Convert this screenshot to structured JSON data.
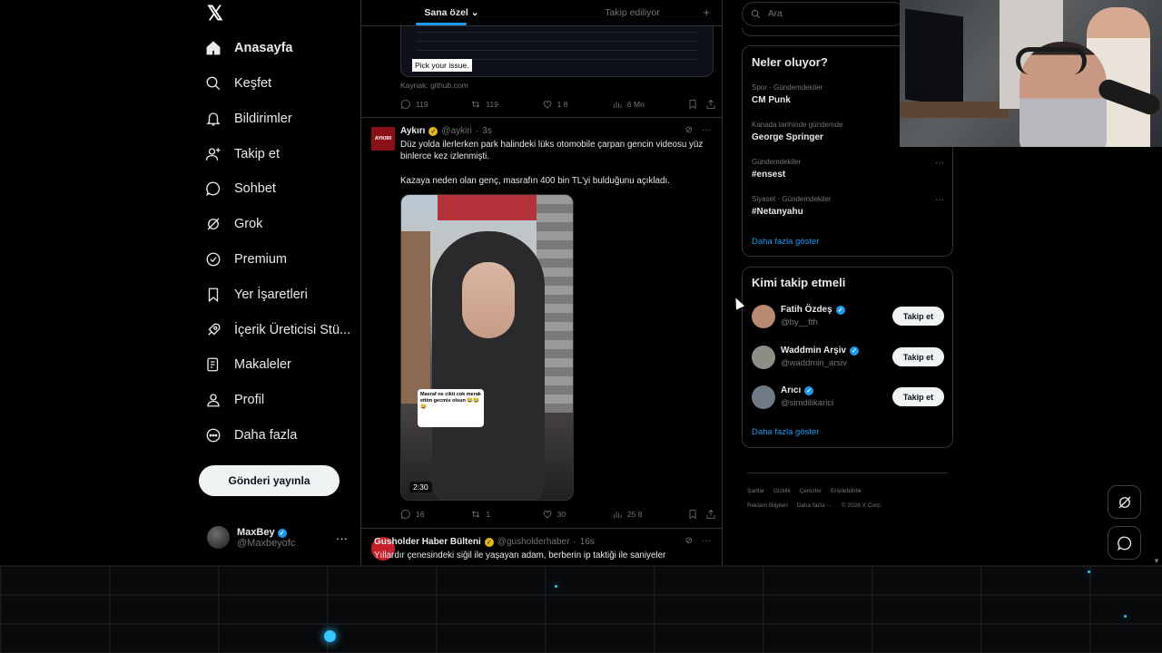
{
  "nav": {
    "logo": "𝕏",
    "items": [
      {
        "label": "Anasayfa",
        "icon": "home-icon"
      },
      {
        "label": "Keşfet",
        "icon": "search-icon"
      },
      {
        "label": "Bildirimler",
        "icon": "bell-icon"
      },
      {
        "label": "Takip et",
        "icon": "person-add-icon"
      },
      {
        "label": "Sohbet",
        "icon": "chat-icon"
      },
      {
        "label": "Grok",
        "icon": "grok-icon"
      },
      {
        "label": "Premium",
        "icon": "premium-icon"
      },
      {
        "label": "Yer İşaretleri",
        "icon": "bookmark-icon"
      },
      {
        "label": "İçerik Üreticisi Stü...",
        "icon": "rocket-icon"
      },
      {
        "label": "Makaleler",
        "icon": "article-icon"
      },
      {
        "label": "Profil",
        "icon": "profile-icon"
      },
      {
        "label": "Daha fazla",
        "icon": "more-circle-icon"
      }
    ],
    "post_button": "Gönderi yayınla",
    "account": {
      "name": "MaxBey",
      "handle": "@Maxbeyofc",
      "more": "···"
    }
  },
  "feed": {
    "tabs": {
      "for_you": "Sana özel",
      "following": "Takip ediliyor",
      "add": "+"
    },
    "prev_post": {
      "card_caption": "Pick your issue.",
      "source": "Kaynak: github.com",
      "replies": "119",
      "reposts": "119",
      "likes": "1 8",
      "views": "6 Mn"
    },
    "post1": {
      "name": "Aykırı",
      "handle": "@aykiri",
      "time": "3s",
      "avatar_text": "AYKIRI",
      "text1": "Düz yolda ilerlerken park halindeki lüks otomobile çarpan gencin videosu yüz binlerce kez izlenmişti.",
      "text2": "Kazaya neden olan genç, masrafın 400 bin TL'yi bulduğunu açıkladı.",
      "sticker": "Masraf ne cikti cok merak ettim gecmis olsun 😂😂😂",
      "duration": "2:30",
      "replies": "16",
      "reposts": "1",
      "likes": "30",
      "views": "25 8"
    },
    "post2": {
      "name": "Gusholder Haber Bülteni",
      "handle": "@gusholderhaber",
      "time": "16s",
      "text1": "Yıllardır çenesindeki siğil ile yaşayan adam, berberin ip taktiği ile saniyeler"
    }
  },
  "sidebar": {
    "search_placeholder": "Ara",
    "trends_title": "Neler oluyor?",
    "trends": [
      {
        "category": "Spor · Gündemdekiler",
        "name": "CM Punk"
      },
      {
        "category": "Kanada tarihinde gündemde",
        "name": "George Springer"
      },
      {
        "category": "Gündemdekiler",
        "name": "#ensest"
      },
      {
        "category": "Siyaset · Gündemdekiler",
        "name": "#Netanyahu"
      }
    ],
    "trends_more": "Daha fazla göster",
    "who_title": "Kimi takip etmeli",
    "who": [
      {
        "name": "Fatih Özdeş",
        "handle": "@by__fth",
        "button": "Takip et",
        "avatar_color": "#b98a72"
      },
      {
        "name": "Waddmin Arşiv",
        "handle": "@waddmin_arsiv",
        "button": "Takip et",
        "avatar_color": "#8d8f86"
      },
      {
        "name": "Arıcı",
        "handle": "@simdilikarici",
        "button": "Takip et",
        "avatar_color": "#6f7a86"
      }
    ],
    "who_more": "Daha fazla göster",
    "footer": {
      "terms": "Şartlar",
      "privacy": "Gizlilik",
      "cookies": "Çerezler",
      "access": "Erişilebilirlik",
      "ads": "Reklam Bilgileri",
      "more": "Daha fazla ···",
      "copy": "© 2026 X Corp."
    }
  },
  "colors": {
    "accent": "#1d9bf0",
    "gold_badge": "#e2b719",
    "bg": "#000000"
  }
}
